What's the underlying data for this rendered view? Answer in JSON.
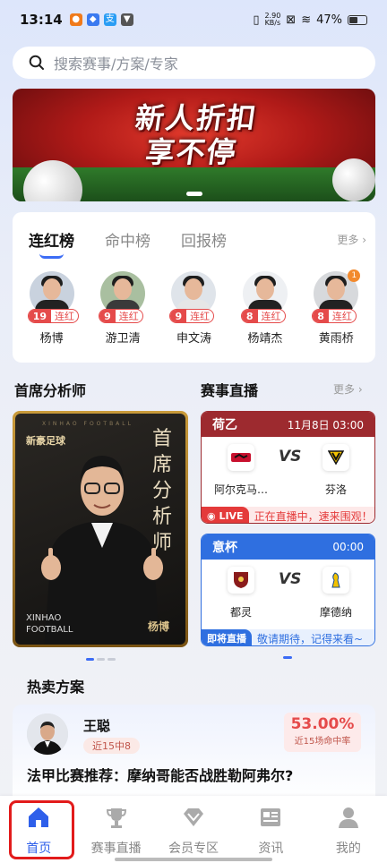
{
  "status_bar": {
    "time": "13:14",
    "net_speed_top": "2.90",
    "net_speed_bottom": "KB/s",
    "battery": "47%"
  },
  "search": {
    "placeholder": "搜索赛事/方案/专家"
  },
  "banner": {
    "line1": "新人折扣",
    "line2": "享不停"
  },
  "ranking": {
    "tabs": [
      {
        "label": "连红榜",
        "active": true
      },
      {
        "label": "命中榜"
      },
      {
        "label": "回报榜"
      }
    ],
    "more": "更多",
    "experts": [
      {
        "name": "杨博",
        "streak": "19",
        "tag": "连红"
      },
      {
        "name": "游卫清",
        "streak": "9",
        "tag": "连红"
      },
      {
        "name": "申文涛",
        "streak": "9",
        "tag": "连红"
      },
      {
        "name": "杨靖杰",
        "streak": "8",
        "tag": "连红"
      },
      {
        "name": "黄雨桥",
        "streak": "8",
        "tag": "连红",
        "badge": "1"
      }
    ]
  },
  "chief": {
    "title": "首席分析师",
    "poster_brand": "新豪足球",
    "poster_en": "XINHAO FOOTBALL",
    "poster_vertical": "首席分析师",
    "poster_footer": "XINHAO FOOTBALL",
    "poster_sig": "杨博"
  },
  "live": {
    "title": "赛事直播",
    "more": "更多",
    "matches": [
      {
        "league": "荷乙",
        "time": "11月8日 03:00",
        "home": "阿尔克马…",
        "away": "芬洛",
        "vs": "VS",
        "status": "LIVE",
        "note": "正在直播中，速来围观！",
        "color": "#9d2a2f"
      },
      {
        "league": "意杯",
        "time": "00:00",
        "home": "都灵",
        "away": "摩德纳",
        "vs": "VS",
        "status": "即将直播",
        "note": "敬请期待，记得来看~",
        "color": "#2f6fe0"
      }
    ]
  },
  "hot": {
    "title": "热卖方案",
    "expert": "王聪",
    "record": "近15中8",
    "rate": "53.00%",
    "rate_label": "近15场命中率",
    "headline": "法甲比赛推荐：摩纳哥能否战胜勒阿弗尔?"
  },
  "nav": [
    {
      "label": "首页",
      "icon": "home-icon",
      "active": true
    },
    {
      "label": "赛事直播",
      "icon": "trophy-icon"
    },
    {
      "label": "会员专区",
      "icon": "diamond-icon"
    },
    {
      "label": "资讯",
      "icon": "news-icon"
    },
    {
      "label": "我的",
      "icon": "profile-icon"
    }
  ],
  "colors": {
    "accent": "#2e5fea",
    "red": "#e54b4b"
  }
}
